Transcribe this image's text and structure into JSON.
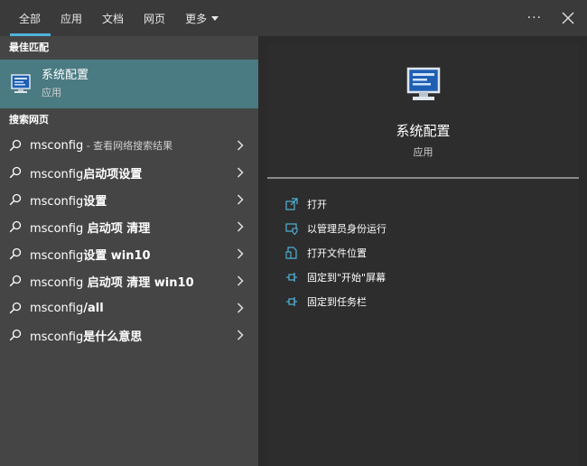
{
  "tabs": [
    {
      "label": "全部",
      "active": true
    },
    {
      "label": "应用",
      "active": false
    },
    {
      "label": "文档",
      "active": false
    },
    {
      "label": "网页",
      "active": false
    },
    {
      "label": "更多",
      "active": false,
      "dropdown": true
    }
  ],
  "topbar": {
    "more_label": "···"
  },
  "left": {
    "best_match_heading": "最佳匹配",
    "best_match": {
      "name": "系统配置",
      "kind": "应用",
      "icon": "system-config-icon"
    },
    "web_heading": "搜索网页",
    "web_items": [
      {
        "strong": "",
        "normal": "msconfig",
        "sub": " - 查看网络搜索结果"
      },
      {
        "normal": "msconfig",
        "strong": "启动项设置",
        "sub": ""
      },
      {
        "normal": "msconfig",
        "strong": "设置",
        "sub": ""
      },
      {
        "normal": "msconfig",
        "strong": " 启动项 清理",
        "sub": ""
      },
      {
        "normal": "msconfig",
        "strong": "设置 win10",
        "sub": ""
      },
      {
        "normal": "msconfig",
        "strong": " 启动项 清理 win10",
        "sub": ""
      },
      {
        "normal": "msconfig",
        "strong": "/all",
        "sub": ""
      },
      {
        "normal": "msconfig",
        "strong": "是什么意思",
        "sub": ""
      }
    ]
  },
  "right": {
    "title": "系统配置",
    "kind": "应用",
    "actions": [
      {
        "label": "打开",
        "icon": "open-icon"
      },
      {
        "label": "以管理员身份运行",
        "icon": "shield-icon"
      },
      {
        "label": "打开文件位置",
        "icon": "file-location-icon"
      },
      {
        "label": "固定到\"开始\"屏幕",
        "icon": "pin-icon"
      },
      {
        "label": "固定到任务栏",
        "icon": "pin-icon"
      }
    ]
  },
  "colors": {
    "accent": "#4fb3d9",
    "selected": "#4a7a82"
  }
}
